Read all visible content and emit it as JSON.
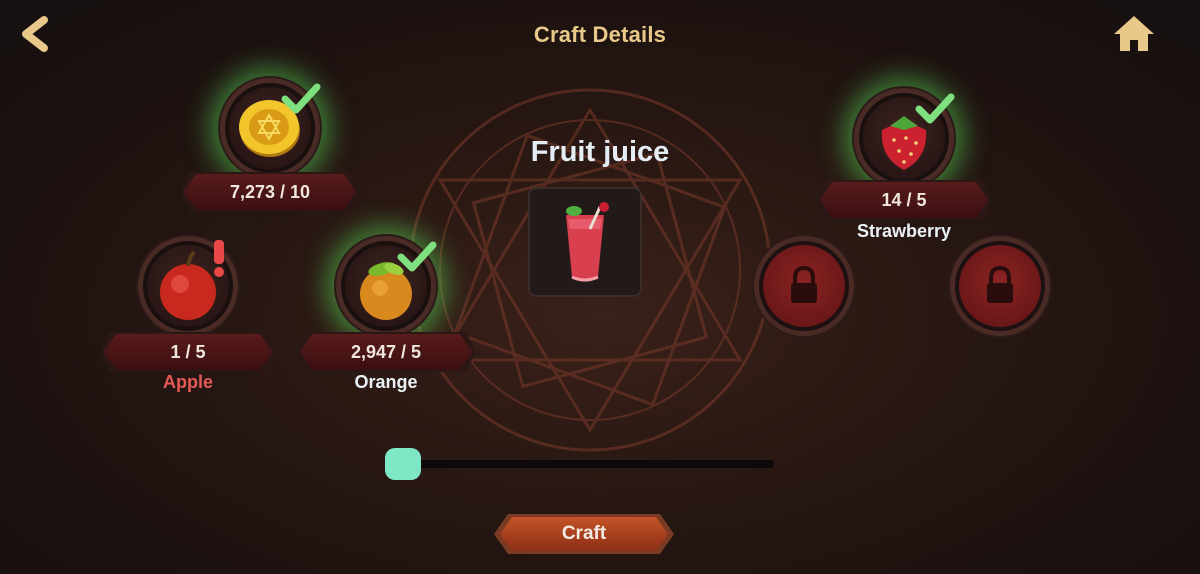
{
  "header": {
    "title": "Craft Details",
    "back_icon": "chevron-left-icon",
    "home_icon": "home-icon"
  },
  "result": {
    "name": "Fruit juice",
    "icon": "fruit-juice-glass-icon"
  },
  "ingredients": [
    {
      "key": "gold",
      "icon": "gold-coin-icon",
      "count": "7,273 / 10",
      "name": "",
      "status": "sufficient"
    },
    {
      "key": "apple",
      "icon": "apple-icon",
      "count": "1 / 5",
      "name": "Apple",
      "status": "insufficient"
    },
    {
      "key": "orange",
      "icon": "orange-icon",
      "count": "2,947 / 5",
      "name": "Orange",
      "status": "sufficient"
    },
    {
      "key": "strawberry",
      "icon": "strawberry-icon",
      "count": "14 / 5",
      "name": "Strawberry",
      "status": "sufficient"
    }
  ],
  "locked_slots": [
    {
      "icon": "lock-icon"
    },
    {
      "icon": "lock-icon"
    }
  ],
  "quantity_slider": {
    "value": 0
  },
  "craft_button": {
    "label": "Craft"
  },
  "colors": {
    "title": "#e9c98a",
    "sufficient_glow": "#5adc5a",
    "insufficient_text": "#e55a55",
    "slider_handle": "#7ee8c6",
    "craft_button": "#c45426"
  }
}
